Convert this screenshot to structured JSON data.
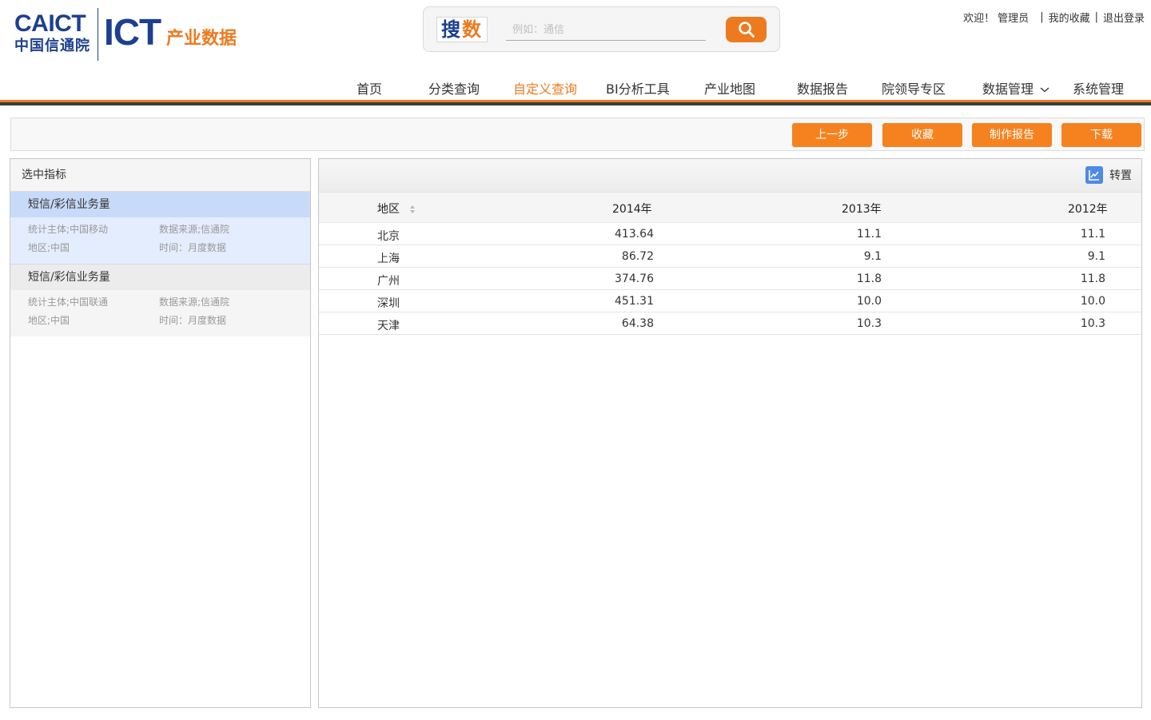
{
  "header": {
    "logo_en": "CAICT",
    "logo_cn": "中国信通院",
    "logo_ict": "ICT",
    "logo_ict_sub": "产业数据",
    "search_logo_1": "搜",
    "search_logo_2": "数",
    "search_placeholder": "例如：通信",
    "search_icon": "search-icon",
    "welcome": "欢迎！",
    "username": "管理员",
    "favorites": "我的收藏",
    "logout": "退出登录"
  },
  "nav": {
    "items": [
      {
        "label": "首页"
      },
      {
        "label": "分类查询"
      },
      {
        "label": "自定义查询"
      },
      {
        "label": "BI分析工具"
      },
      {
        "label": "产业地图"
      },
      {
        "label": "数据报告"
      },
      {
        "label": "院领导专区"
      },
      {
        "label": "数据管理"
      },
      {
        "label": "系统管理"
      }
    ],
    "active_index": 2,
    "accent_color": "#ee7a1f"
  },
  "toolbar": {
    "prev_label": "上一步",
    "favorite_label": "收藏",
    "report_label": "制作报告",
    "download_label": "下载"
  },
  "left_panel": {
    "title": "选中指标",
    "indicators": [
      {
        "name": "短信/彩信业务量",
        "subject": "统计主体;中国移动",
        "source": "数据来源;信通院",
        "region": "地区;中国",
        "time": "时间：月度数据"
      },
      {
        "name": "短信/彩信业务量",
        "subject": "统计主体;中国联通",
        "source": "数据来源;信通院",
        "region": "地区;中国",
        "time": "时间：月度数据"
      }
    ]
  },
  "right_panel": {
    "transpose_label": "转置",
    "table": {
      "headers": [
        "地区",
        "2014年",
        "2013年",
        "2012年"
      ],
      "rows": [
        [
          "北京",
          "413.64",
          "11.1",
          "11.1"
        ],
        [
          "上海",
          "86.72",
          "9.1",
          "9.1"
        ],
        [
          "广州",
          "374.76",
          "11.8",
          "11.8"
        ],
        [
          "深圳",
          "451.31",
          "10.0",
          "10.0"
        ],
        [
          "天津",
          "64.38",
          "10.3",
          "10.3"
        ]
      ]
    }
  }
}
